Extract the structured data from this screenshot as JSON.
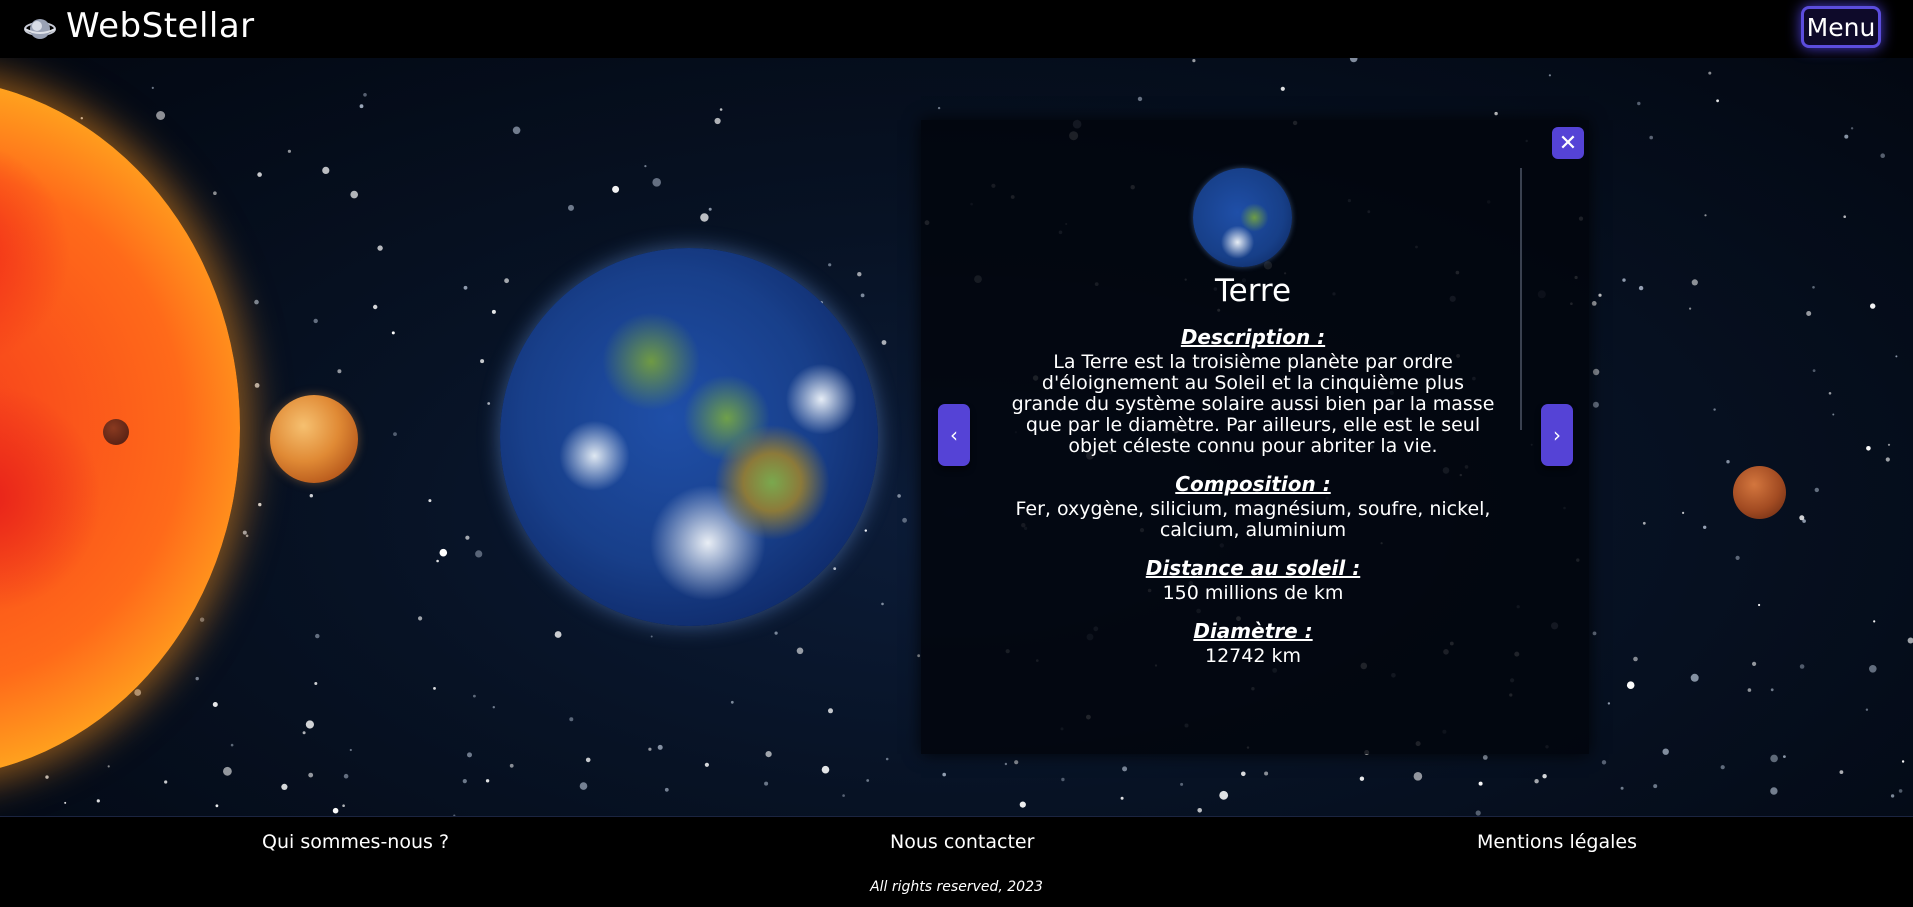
{
  "header": {
    "brand": "WebStellar",
    "menu_label": "Menu",
    "logo_icon": "planet-logo-icon"
  },
  "panel": {
    "close_label": "✕",
    "prev_label": "‹",
    "next_label": "›",
    "planet_name": "Terre",
    "description_title": "Description :",
    "description_text": "La Terre est la troisième planète par ordre d'éloignement au Soleil et la cinquième plus grande du système solaire aussi bien par la masse que par le diamètre. Par ailleurs, elle est le seul objet céleste connu pour abriter la vie.",
    "composition_title": "Composition :",
    "composition_text": "Fer, oxygène, silicium, magnésium, soufre, nickel, calcium, aluminium",
    "distance_title": "Distance au soleil :",
    "distance_text": "150 millions de km",
    "diameter_title": "Diamètre :",
    "diameter_text": "12742 km"
  },
  "footer": {
    "about_label": "Qui sommes-nous ?",
    "contact_label": "Nous contacter",
    "legal_label": "Mentions légales",
    "copyright": "All rights reserved, 2023"
  },
  "colors": {
    "accent": "#5543d6",
    "background": "#000000"
  }
}
